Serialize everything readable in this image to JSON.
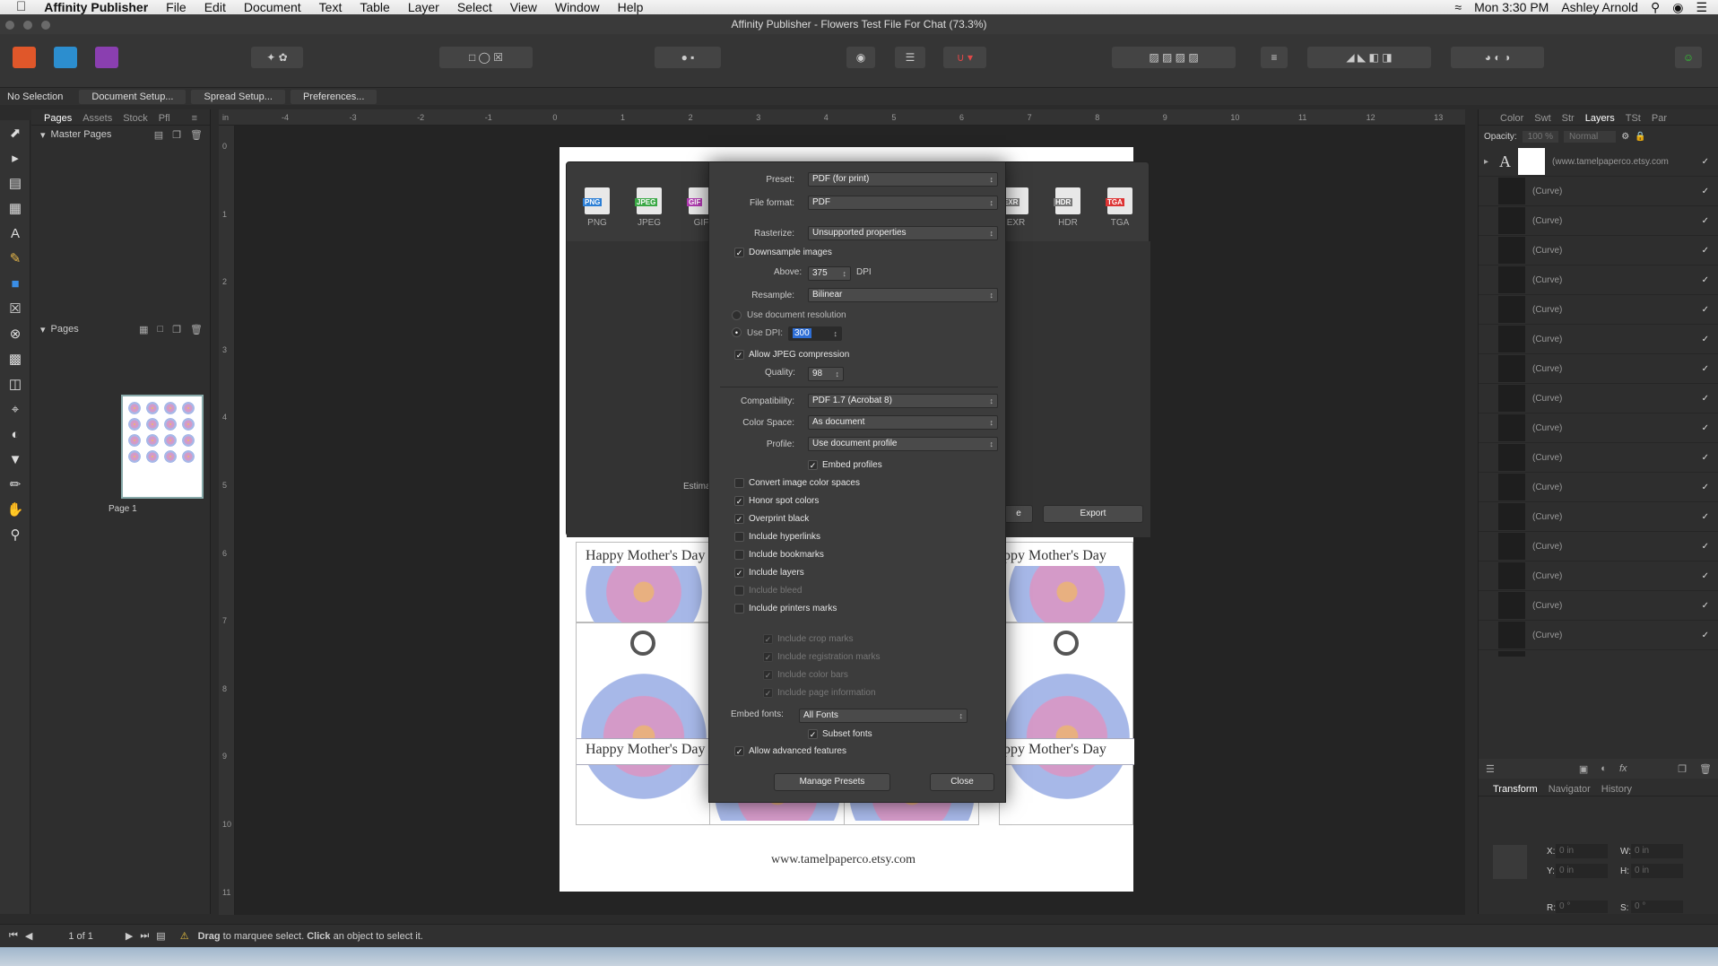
{
  "menubar": {
    "app": "Affinity Publisher",
    "items": [
      "File",
      "Edit",
      "Document",
      "Text",
      "Table",
      "Layer",
      "Select",
      "View",
      "Window",
      "Help"
    ],
    "clock": "Mon 3:30 PM",
    "user": "Ashley Arnold"
  },
  "window": {
    "title": "Affinity Publisher - Flowers Test File For Chat (73.3%)"
  },
  "context": {
    "selection": "No Selection",
    "buttons": [
      "Document Setup...",
      "Spread Setup...",
      "Preferences..."
    ]
  },
  "left_panel": {
    "tabs": [
      "Pages",
      "Assets",
      "Stock",
      "Pfl"
    ],
    "master_pages": "Master Pages",
    "pages": "Pages",
    "page1_label": "Page 1"
  },
  "right_panel": {
    "tabs": [
      "Color",
      "Swt",
      "Str",
      "Layers",
      "TSt",
      "Par"
    ],
    "opacity_label": "Opacity:",
    "opacity_value": "100 %",
    "blend": "Normal",
    "text_layer": "(www.tamelpaperco.etsy.com",
    "curve_label": "(Curve)",
    "bottom_tabs": [
      "Transform",
      "Navigator",
      "History"
    ],
    "transform": {
      "x_label": "X:",
      "y_label": "Y:",
      "w_label": "W:",
      "h_label": "H:",
      "r_label": "R:",
      "s_label": "S:",
      "x": "0 in",
      "y": "0 in",
      "w": "0 in",
      "h": "0 in",
      "r": "0 °",
      "s": "0 °"
    }
  },
  "rulers": {
    "h": [
      "-4",
      "-3",
      "-2",
      "-1",
      "0",
      "1",
      "2",
      "3",
      "4",
      "5",
      "6",
      "7",
      "8",
      "9",
      "10",
      "11",
      "12",
      "13"
    ],
    "v": [
      "0",
      "1",
      "2",
      "3",
      "4",
      "5",
      "6",
      "7",
      "8",
      "9",
      "10",
      "11"
    ],
    "unit": "in"
  },
  "export": {
    "formats_left": [
      "PNG",
      "JPEG",
      "GIF"
    ],
    "formats_right": [
      "EXR",
      "HDR",
      "TGA"
    ],
    "estimate_label": "Estima",
    "export_button": "Export",
    "hidden_button": "e"
  },
  "settings": {
    "preset_label": "Preset:",
    "preset": "PDF (for print)",
    "format_label": "File format:",
    "format": "PDF",
    "rasterize_label": "Rasterize:",
    "rasterize": "Unsupported properties",
    "downsample": "Downsample images",
    "above_label": "Above:",
    "above": "375",
    "dpi": "DPI",
    "resample_label": "Resample:",
    "resample": "Bilinear",
    "use_doc_res": "Use document resolution",
    "use_dpi_label": "Use DPI:",
    "use_dpi": "300",
    "allow_jpeg": "Allow JPEG compression",
    "quality_label": "Quality:",
    "quality": "98",
    "compat_label": "Compatibility:",
    "compat": "PDF 1.7 (Acrobat 8)",
    "colorspace_label": "Color Space:",
    "colorspace": "As document",
    "profile_label": "Profile:",
    "profile": "Use document profile",
    "embed_profiles": "Embed profiles",
    "options": [
      {
        "label": "Convert image color spaces",
        "checked": false,
        "disabled": false
      },
      {
        "label": "Honor spot colors",
        "checked": true,
        "disabled": false
      },
      {
        "label": "Overprint black",
        "checked": true,
        "disabled": false
      },
      {
        "label": "Include hyperlinks",
        "checked": false,
        "disabled": false
      },
      {
        "label": "Include bookmarks",
        "checked": false,
        "disabled": false
      },
      {
        "label": "Include layers",
        "checked": true,
        "disabled": false
      },
      {
        "label": "Include bleed",
        "checked": false,
        "disabled": true
      },
      {
        "label": "Include printers marks",
        "checked": false,
        "disabled": false
      }
    ],
    "marks": [
      "Include crop marks",
      "Include registration marks",
      "Include color bars",
      "Include page information"
    ],
    "embed_fonts_label": "Embed  fonts:",
    "embed_fonts": "All Fonts",
    "subset_fonts": "Subset fonts",
    "advanced": "Allow advanced features",
    "manage_presets": "Manage Presets",
    "close": "Close"
  },
  "page": {
    "card_text": "Happy Mother's Day",
    "card_text_cut": "ppy Mother's Day",
    "footer": "www.tamelpaperco.etsy.com"
  },
  "status": {
    "pages": "1 of 1",
    "hint_bold1": "Drag",
    "hint1": " to marquee select. ",
    "hint_bold2": "Click",
    "hint2": " an object to select it."
  }
}
